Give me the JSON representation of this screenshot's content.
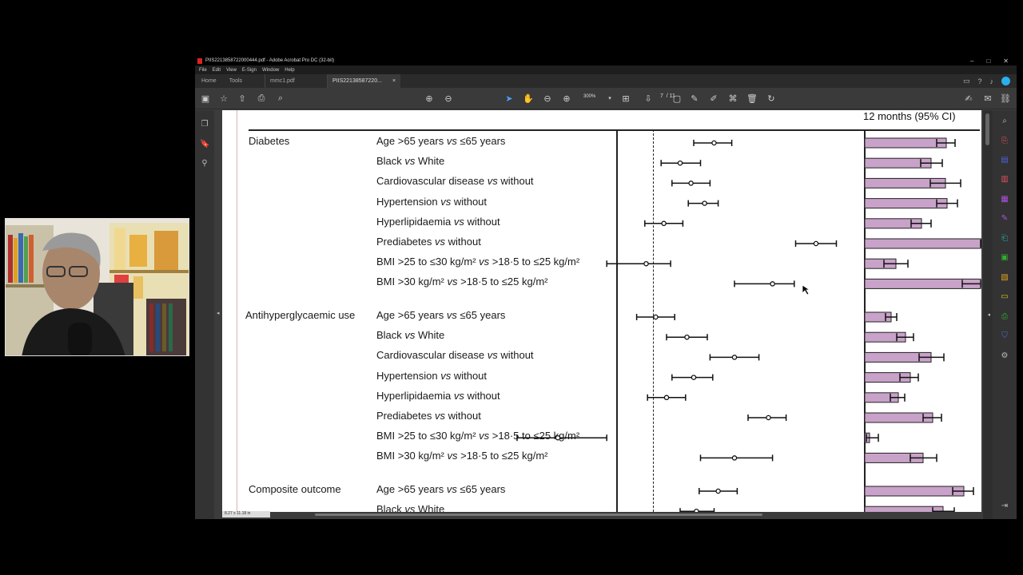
{
  "window": {
    "title": "PIIS2213858722000444.pdf - Adobe Acrobat Pro DC (32-bit)",
    "controls": [
      "–",
      "□",
      "✕"
    ]
  },
  "menu": [
    "File",
    "Edit",
    "View",
    "E-Sign",
    "Window",
    "Help"
  ],
  "tabs": {
    "home": "Home",
    "tools": "Tools",
    "doc1": "mmc1.pdf",
    "doc2": "PIIS22138587220...",
    "close": "×"
  },
  "toolbar": {
    "page_current": "7",
    "page_total": "/ 11",
    "zoom": "300%"
  },
  "status": {
    "page_size": "8.27 x 11.18 in"
  },
  "table": {
    "header": "12 months (95% CI)",
    "groups": [
      {
        "label": "Diabetes",
        "rows": [
          {
            "label_parts": [
              "Age >65 years ",
              "vs",
              " ≤65 years"
            ]
          },
          {
            "label_parts": [
              "Black ",
              "vs",
              " White"
            ]
          },
          {
            "label_parts": [
              "Cardiovascular disease ",
              "vs",
              " without"
            ]
          },
          {
            "label_parts": [
              "Hypertension ",
              "vs",
              " without"
            ]
          },
          {
            "label_parts": [
              "Hyperlipidaemia ",
              "vs",
              " without"
            ]
          },
          {
            "label_parts": [
              "Prediabetes ",
              "vs",
              " without"
            ]
          },
          {
            "label_parts": [
              "BMI >25 to ≤30 kg/m² ",
              "vs",
              " >18·5 to ≤25 kg/m²"
            ]
          },
          {
            "label_parts": [
              "BMI >30 kg/m² ",
              "vs",
              " >18·5 to ≤25 kg/m²"
            ]
          }
        ]
      },
      {
        "label": "Antihyperglycaemic use",
        "rows": [
          {
            "label_parts": [
              "Age >65 years ",
              "vs",
              " ≤65 years"
            ]
          },
          {
            "label_parts": [
              "Black ",
              "vs",
              " White"
            ]
          },
          {
            "label_parts": [
              "Cardiovascular disease ",
              "vs",
              " without"
            ]
          },
          {
            "label_parts": [
              "Hypertension ",
              "vs",
              " without"
            ]
          },
          {
            "label_parts": [
              "Hyperlipidaemia ",
              "vs",
              " without"
            ]
          },
          {
            "label_parts": [
              "Prediabetes ",
              "vs",
              " without"
            ]
          },
          {
            "label_parts": [
              "BMI >25 to ≤30 kg/m² ",
              "vs",
              " >18·5 to ≤25 kg/m²"
            ]
          },
          {
            "label_parts": [
              "BMI >30 kg/m² ",
              "vs",
              " >18·5 to ≤25 kg/m²"
            ]
          }
        ]
      },
      {
        "label": "Composite outcome",
        "rows": [
          {
            "label_parts": [
              "Age >65 years ",
              "vs",
              " ≤65 years"
            ]
          },
          {
            "label_parts": [
              "Black ",
              "vs",
              " White"
            ]
          }
        ]
      }
    ]
  },
  "chart_data": [
    {
      "type": "scatter",
      "description_role": "forest-plot",
      "reference_line": 1.0,
      "series": [
        {
          "estimates": [
            1.45,
            1.2,
            1.28,
            1.38,
            1.08,
            2.2,
            0.95,
            1.88,
            1.02,
            1.25,
            1.6,
            1.3,
            1.1,
            1.85,
            0.3,
            1.6,
            1.48,
            1.32
          ],
          "ci_low": [
            1.3,
            1.06,
            1.14,
            1.26,
            0.94,
            2.05,
            0.66,
            1.6,
            0.88,
            1.1,
            1.42,
            1.14,
            0.96,
            1.7,
            0.0,
            1.35,
            1.34,
            1.2
          ],
          "ci_high": [
            1.58,
            1.35,
            1.42,
            1.48,
            1.22,
            2.35,
            1.13,
            2.04,
            1.16,
            1.4,
            1.78,
            1.44,
            1.24,
            1.98,
            0.66,
            1.88,
            1.62,
            1.45
          ]
        }
      ]
    },
    {
      "type": "bar",
      "series": [
        {
          "values": [
            1.02,
            0.83,
            1.01,
            1.03,
            0.71,
            1.55,
            0.39,
            1.45,
            0.33,
            0.51,
            0.83,
            0.57,
            0.42,
            0.85,
            0.06,
            0.73,
            1.24,
            0.98
          ],
          "ci_low": [
            0.9,
            0.7,
            0.82,
            0.9,
            0.58,
            1.5,
            0.24,
            1.22,
            0.26,
            0.4,
            0.68,
            0.44,
            0.32,
            0.73,
            0.02,
            0.57,
            1.1,
            0.85
          ],
          "ci_high": [
            1.13,
            0.97,
            1.2,
            1.16,
            0.83,
            1.55,
            0.54,
            1.45,
            0.4,
            0.61,
            0.99,
            0.67,
            0.5,
            0.96,
            0.17,
            0.9,
            1.36,
            1.12
          ]
        }
      ]
    }
  ]
}
